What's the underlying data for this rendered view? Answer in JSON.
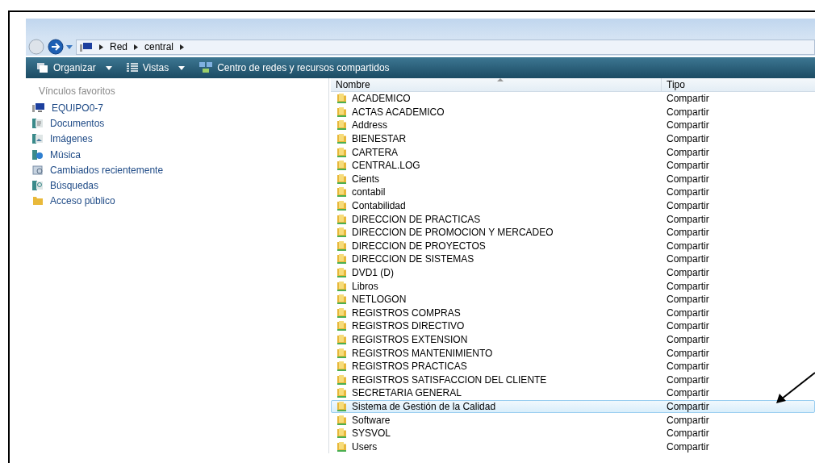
{
  "address_bar": {
    "crumbs": [
      "Red",
      "central"
    ]
  },
  "toolbar": {
    "items": [
      {
        "label": "Organizar",
        "dropdown": true
      },
      {
        "label": "Vistas",
        "dropdown": true
      },
      {
        "label": "Centro de redes y recursos compartidos",
        "dropdown": false
      }
    ]
  },
  "sidebar": {
    "title": "Vínculos favoritos",
    "items": [
      {
        "label": "EQUIPO0-7",
        "kind": "computer"
      },
      {
        "label": "Documentos",
        "kind": "documents"
      },
      {
        "label": "Imágenes",
        "kind": "pictures"
      },
      {
        "label": "Música",
        "kind": "music"
      },
      {
        "label": "Cambiados recientemente",
        "kind": "recent"
      },
      {
        "label": "Búsquedas",
        "kind": "searches"
      },
      {
        "label": "Acceso público",
        "kind": "folder"
      }
    ]
  },
  "table": {
    "columns": [
      "Nombre",
      "Tipo"
    ],
    "rows": [
      {
        "name": "ACADEMICO",
        "type": "Compartir",
        "selected": false
      },
      {
        "name": "ACTAS ACADEMICO",
        "type": "Compartir",
        "selected": false
      },
      {
        "name": "Address",
        "type": "Compartir",
        "selected": false
      },
      {
        "name": "BIENESTAR",
        "type": "Compartir",
        "selected": false
      },
      {
        "name": "CARTERA",
        "type": "Compartir",
        "selected": false
      },
      {
        "name": "CENTRAL.LOG",
        "type": "Compartir",
        "selected": false
      },
      {
        "name": "Cients",
        "type": "Compartir",
        "selected": false
      },
      {
        "name": "contabil",
        "type": "Compartir",
        "selected": false
      },
      {
        "name": "Contabilidad",
        "type": "Compartir",
        "selected": false
      },
      {
        "name": "DIRECCION DE PRACTICAS",
        "type": "Compartir",
        "selected": false
      },
      {
        "name": "DIRECCION DE PROMOCION Y MERCADEO",
        "type": "Compartir",
        "selected": false
      },
      {
        "name": "DIRECCION DE PROYECTOS",
        "type": "Compartir",
        "selected": false
      },
      {
        "name": "DIRECCION DE SISTEMAS",
        "type": "Compartir",
        "selected": false
      },
      {
        "name": "DVD1 (D)",
        "type": "Compartir",
        "selected": false
      },
      {
        "name": "Libros",
        "type": "Compartir",
        "selected": false
      },
      {
        "name": "NETLOGON",
        "type": "Compartir",
        "selected": false
      },
      {
        "name": "REGISTROS COMPRAS",
        "type": "Compartir",
        "selected": false
      },
      {
        "name": "REGISTROS DIRECTIVO",
        "type": "Compartir",
        "selected": false
      },
      {
        "name": "REGISTROS EXTENSION",
        "type": "Compartir",
        "selected": false
      },
      {
        "name": "REGISTROS MANTENIMIENTO",
        "type": "Compartir",
        "selected": false
      },
      {
        "name": "REGISTROS PRACTICAS",
        "type": "Compartir",
        "selected": false
      },
      {
        "name": "REGISTROS SATISFACCION DEL CLIENTE",
        "type": "Compartir",
        "selected": false
      },
      {
        "name": "SECRETARIA GENERAL",
        "type": "Compartir",
        "selected": false
      },
      {
        "name": "Sistema de Gestión de la Calidad",
        "type": "Compartir",
        "selected": true
      },
      {
        "name": "Software",
        "type": "Compartir",
        "selected": false
      },
      {
        "name": "SYSVOL",
        "type": "Compartir",
        "selected": false
      },
      {
        "name": "Users",
        "type": "Compartir",
        "selected": false
      }
    ]
  }
}
